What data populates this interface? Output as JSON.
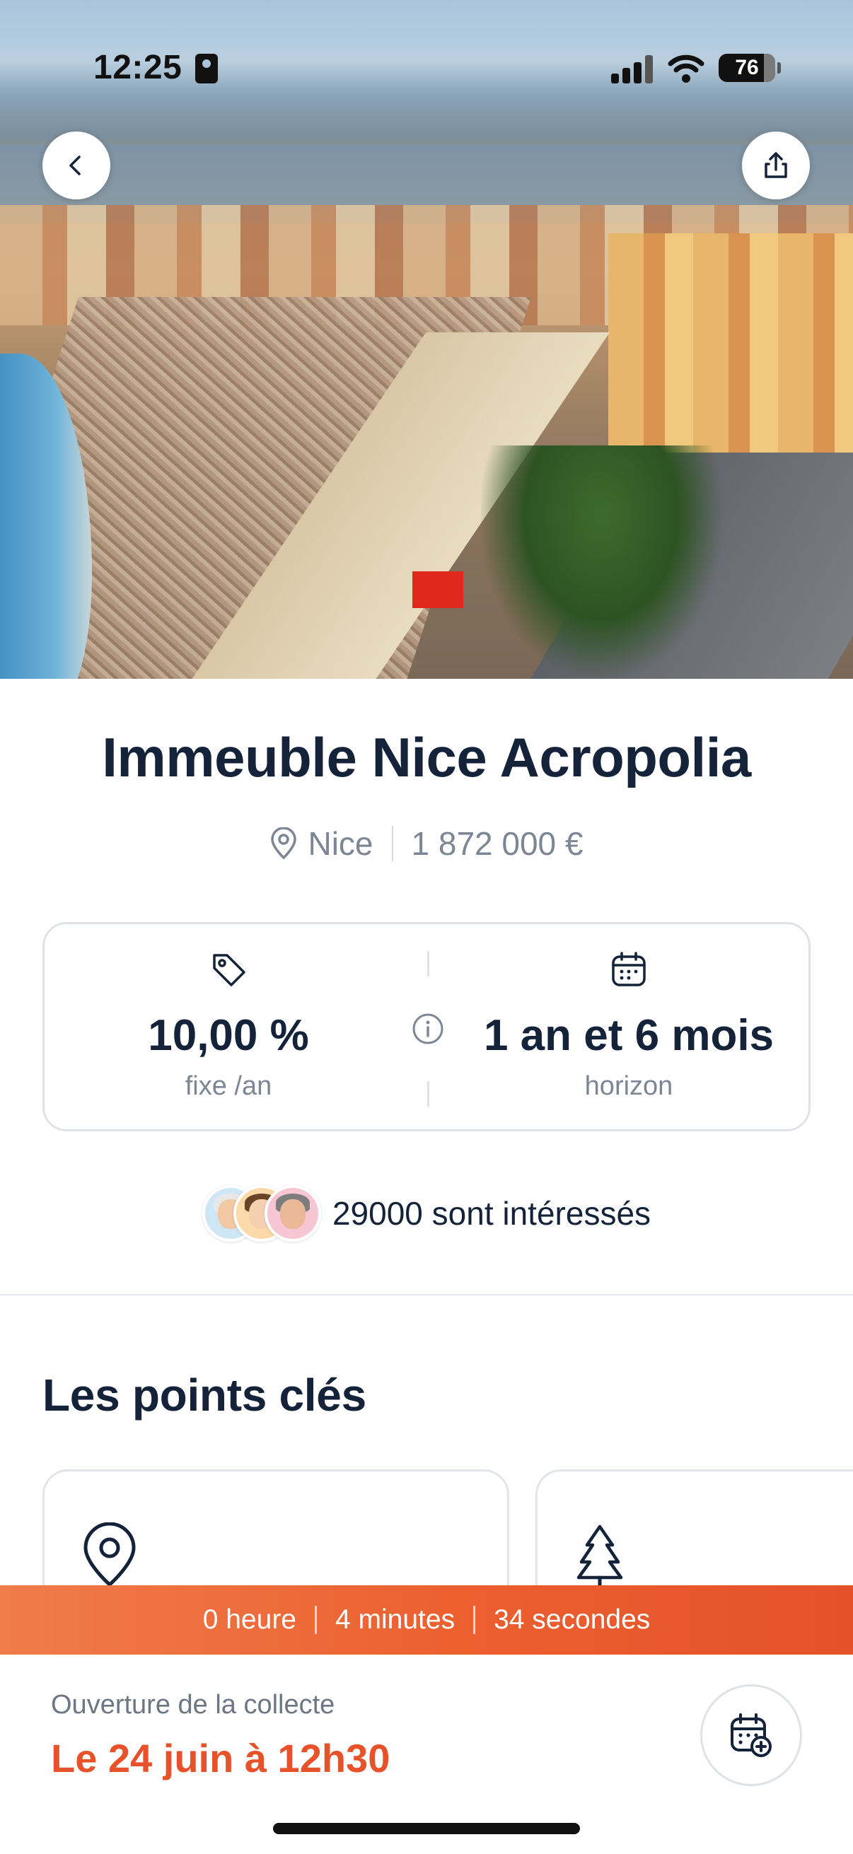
{
  "status_bar": {
    "time": "12:25",
    "battery": "76",
    "icons": [
      "contact-card-icon",
      "cellular-signal-icon",
      "wifi-icon",
      "battery-icon"
    ]
  },
  "header": {
    "back_icon": "chevron-left-icon",
    "share_icon": "share-icon"
  },
  "hero_image": {
    "subject": "photo"
  },
  "property": {
    "title": "Immeuble Nice Acropolia",
    "location": "Nice",
    "price": "1 872 000 €"
  },
  "stats": {
    "rate_value": "10,00 %",
    "rate_label": "fixe /an",
    "horizon_value": "1 an et 6 mois",
    "horizon_label": "horizon",
    "rate_icon": "tag-icon",
    "horizon_icon": "calendar-icon",
    "info_icon": "info-icon"
  },
  "interest": {
    "count_text": "29000 sont intéressés"
  },
  "key_points": {
    "title": "Les points clés",
    "cards": [
      {
        "icon": "location-pin-icon"
      },
      {
        "icon": "tree-icon"
      }
    ]
  },
  "countdown": {
    "hours": "0 heure",
    "minutes": "4 minutes",
    "seconds": "34 secondes"
  },
  "opening": {
    "label": "Ouverture de la collecte",
    "date": "Le 24 juin à 12h30",
    "calendar_icon": "calendar-add-icon"
  },
  "colors": {
    "primary_text": "#14233a",
    "secondary_text": "#7c8694",
    "accent": "#e8522a",
    "timer_start": "#f07c4a",
    "timer_end": "#e4522a"
  }
}
